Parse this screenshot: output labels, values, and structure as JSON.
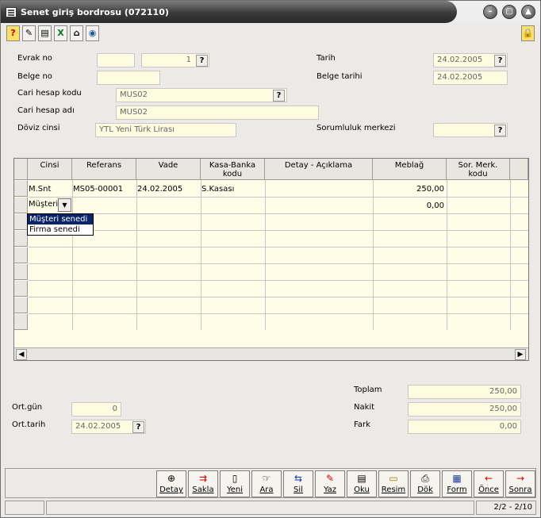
{
  "window": {
    "title": "Senet giriş bordrosu (072110)"
  },
  "toolbar": {
    "buttons": [
      {
        "icon": "help-icon",
        "glyph": "?"
      },
      {
        "icon": "edit-icon",
        "glyph": "✎"
      },
      {
        "icon": "print-icon",
        "glyph": "▤"
      },
      {
        "icon": "excel-icon",
        "glyph": "X"
      },
      {
        "icon": "home-icon",
        "glyph": "⌂"
      },
      {
        "icon": "view-icon",
        "glyph": "◉"
      }
    ],
    "lock_icon": "lock-icon"
  },
  "form": {
    "evrak_no_label": "Evrak no",
    "evrak_no_value": "",
    "evrak_no_num": "1",
    "belge_no_label": "Belge no",
    "belge_no_value": "",
    "cari_kod_label": "Cari hesap kodu",
    "cari_kod_value": "MUS02",
    "cari_adi_label": "Cari hesap adı",
    "cari_adi_value": "MUS02",
    "doviz_label": "Döviz cinsi",
    "doviz_value": "YTL Yeni Türk Lirası",
    "tarih_label": "Tarih",
    "tarih_value": "24.02.2005",
    "belge_tarihi_label": "Belge tarihi",
    "belge_tarihi_value": "24.02.2005",
    "sorumluluk_label": "Sorumluluk merkezi",
    "sorumluluk_value": "",
    "q": "?"
  },
  "grid": {
    "headers": [
      "Cinsi",
      "Referans",
      "Vade",
      "Kasa-Banka kodu",
      "Detay - Açıklama",
      "Meblağ",
      "Sor. Merk. kodu"
    ],
    "rows": [
      {
        "cinsi": "M.Snt",
        "referans": "MS05-00001",
        "vade": "24.02.2005",
        "kasa": "S.Kasası",
        "detay": "",
        "meblag": "250,00",
        "sor": ""
      },
      {
        "cinsi": "Müşteri s",
        "referans": "",
        "vade": "",
        "kasa": "",
        "detay": "",
        "meblag": "0,00",
        "sor": ""
      }
    ],
    "dropdown_options": [
      "Müşteri senedi",
      "Firma senedi"
    ],
    "dropdown_selected": "Müşteri senedi"
  },
  "summary": {
    "ort_gun_label": "Ort.gün",
    "ort_gun_value": "0",
    "ort_tarih_label": "Ort.tarih",
    "ort_tarih_value": "24.02.2005",
    "toplam_label": "Toplam",
    "toplam_value": "250,00",
    "nakit_label": "Nakit",
    "nakit_value": "250,00",
    "fark_label": "Fark",
    "fark_value": "0,00"
  },
  "actions": [
    {
      "label": "Detay",
      "icon": "zoom-icon",
      "glyph": "🔍"
    },
    {
      "label": "Sakla",
      "icon": "save-icon",
      "glyph": "⇉"
    },
    {
      "label": "Yeni",
      "icon": "new-icon",
      "glyph": "▯"
    },
    {
      "label": "Ara",
      "icon": "search-icon",
      "glyph": "☞"
    },
    {
      "label": "Sil",
      "icon": "delete-icon",
      "glyph": "⇆"
    },
    {
      "label": "Yaz",
      "icon": "write-icon",
      "glyph": "✎"
    },
    {
      "label": "Oku",
      "icon": "read-icon",
      "glyph": "▤"
    },
    {
      "label": "Resim",
      "icon": "image-icon",
      "glyph": "▭"
    },
    {
      "label": "Dök",
      "icon": "print-icon",
      "glyph": "⎙"
    },
    {
      "label": "Form",
      "icon": "form-icon",
      "glyph": "▦"
    },
    {
      "label": "Önce",
      "icon": "prev-icon",
      "glyph": "←"
    },
    {
      "label": "Sonra",
      "icon": "next-icon",
      "glyph": "→"
    }
  ],
  "status": {
    "left": "",
    "middle": "",
    "page": "2/2 - 2/10"
  }
}
